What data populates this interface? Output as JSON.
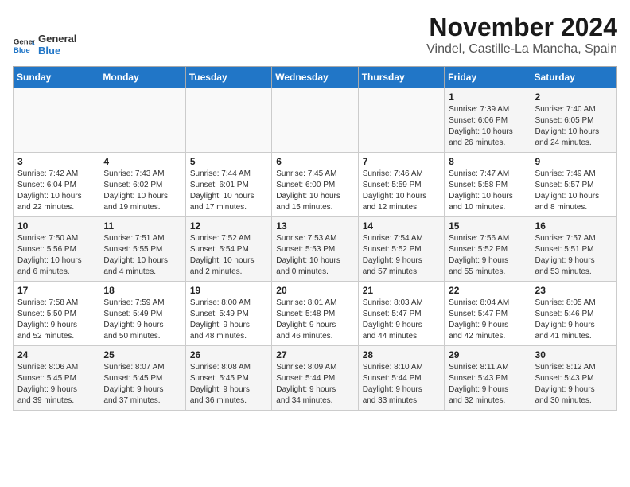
{
  "header": {
    "logo_line1": "General",
    "logo_line2": "Blue",
    "month_year": "November 2024",
    "location": "Vindel, Castille-La Mancha, Spain"
  },
  "weekdays": [
    "Sunday",
    "Monday",
    "Tuesday",
    "Wednesday",
    "Thursday",
    "Friday",
    "Saturday"
  ],
  "weeks": [
    [
      {
        "day": "",
        "info": ""
      },
      {
        "day": "",
        "info": ""
      },
      {
        "day": "",
        "info": ""
      },
      {
        "day": "",
        "info": ""
      },
      {
        "day": "",
        "info": ""
      },
      {
        "day": "1",
        "info": "Sunrise: 7:39 AM\nSunset: 6:06 PM\nDaylight: 10 hours\nand 26 minutes."
      },
      {
        "day": "2",
        "info": "Sunrise: 7:40 AM\nSunset: 6:05 PM\nDaylight: 10 hours\nand 24 minutes."
      }
    ],
    [
      {
        "day": "3",
        "info": "Sunrise: 7:42 AM\nSunset: 6:04 PM\nDaylight: 10 hours\nand 22 minutes."
      },
      {
        "day": "4",
        "info": "Sunrise: 7:43 AM\nSunset: 6:02 PM\nDaylight: 10 hours\nand 19 minutes."
      },
      {
        "day": "5",
        "info": "Sunrise: 7:44 AM\nSunset: 6:01 PM\nDaylight: 10 hours\nand 17 minutes."
      },
      {
        "day": "6",
        "info": "Sunrise: 7:45 AM\nSunset: 6:00 PM\nDaylight: 10 hours\nand 15 minutes."
      },
      {
        "day": "7",
        "info": "Sunrise: 7:46 AM\nSunset: 5:59 PM\nDaylight: 10 hours\nand 12 minutes."
      },
      {
        "day": "8",
        "info": "Sunrise: 7:47 AM\nSunset: 5:58 PM\nDaylight: 10 hours\nand 10 minutes."
      },
      {
        "day": "9",
        "info": "Sunrise: 7:49 AM\nSunset: 5:57 PM\nDaylight: 10 hours\nand 8 minutes."
      }
    ],
    [
      {
        "day": "10",
        "info": "Sunrise: 7:50 AM\nSunset: 5:56 PM\nDaylight: 10 hours\nand 6 minutes."
      },
      {
        "day": "11",
        "info": "Sunrise: 7:51 AM\nSunset: 5:55 PM\nDaylight: 10 hours\nand 4 minutes."
      },
      {
        "day": "12",
        "info": "Sunrise: 7:52 AM\nSunset: 5:54 PM\nDaylight: 10 hours\nand 2 minutes."
      },
      {
        "day": "13",
        "info": "Sunrise: 7:53 AM\nSunset: 5:53 PM\nDaylight: 10 hours\nand 0 minutes."
      },
      {
        "day": "14",
        "info": "Sunrise: 7:54 AM\nSunset: 5:52 PM\nDaylight: 9 hours\nand 57 minutes."
      },
      {
        "day": "15",
        "info": "Sunrise: 7:56 AM\nSunset: 5:52 PM\nDaylight: 9 hours\nand 55 minutes."
      },
      {
        "day": "16",
        "info": "Sunrise: 7:57 AM\nSunset: 5:51 PM\nDaylight: 9 hours\nand 53 minutes."
      }
    ],
    [
      {
        "day": "17",
        "info": "Sunrise: 7:58 AM\nSunset: 5:50 PM\nDaylight: 9 hours\nand 52 minutes."
      },
      {
        "day": "18",
        "info": "Sunrise: 7:59 AM\nSunset: 5:49 PM\nDaylight: 9 hours\nand 50 minutes."
      },
      {
        "day": "19",
        "info": "Sunrise: 8:00 AM\nSunset: 5:49 PM\nDaylight: 9 hours\nand 48 minutes."
      },
      {
        "day": "20",
        "info": "Sunrise: 8:01 AM\nSunset: 5:48 PM\nDaylight: 9 hours\nand 46 minutes."
      },
      {
        "day": "21",
        "info": "Sunrise: 8:03 AM\nSunset: 5:47 PM\nDaylight: 9 hours\nand 44 minutes."
      },
      {
        "day": "22",
        "info": "Sunrise: 8:04 AM\nSunset: 5:47 PM\nDaylight: 9 hours\nand 42 minutes."
      },
      {
        "day": "23",
        "info": "Sunrise: 8:05 AM\nSunset: 5:46 PM\nDaylight: 9 hours\nand 41 minutes."
      }
    ],
    [
      {
        "day": "24",
        "info": "Sunrise: 8:06 AM\nSunset: 5:45 PM\nDaylight: 9 hours\nand 39 minutes."
      },
      {
        "day": "25",
        "info": "Sunrise: 8:07 AM\nSunset: 5:45 PM\nDaylight: 9 hours\nand 37 minutes."
      },
      {
        "day": "26",
        "info": "Sunrise: 8:08 AM\nSunset: 5:45 PM\nDaylight: 9 hours\nand 36 minutes."
      },
      {
        "day": "27",
        "info": "Sunrise: 8:09 AM\nSunset: 5:44 PM\nDaylight: 9 hours\nand 34 minutes."
      },
      {
        "day": "28",
        "info": "Sunrise: 8:10 AM\nSunset: 5:44 PM\nDaylight: 9 hours\nand 33 minutes."
      },
      {
        "day": "29",
        "info": "Sunrise: 8:11 AM\nSunset: 5:43 PM\nDaylight: 9 hours\nand 32 minutes."
      },
      {
        "day": "30",
        "info": "Sunrise: 8:12 AM\nSunset: 5:43 PM\nDaylight: 9 hours\nand 30 minutes."
      }
    ]
  ]
}
